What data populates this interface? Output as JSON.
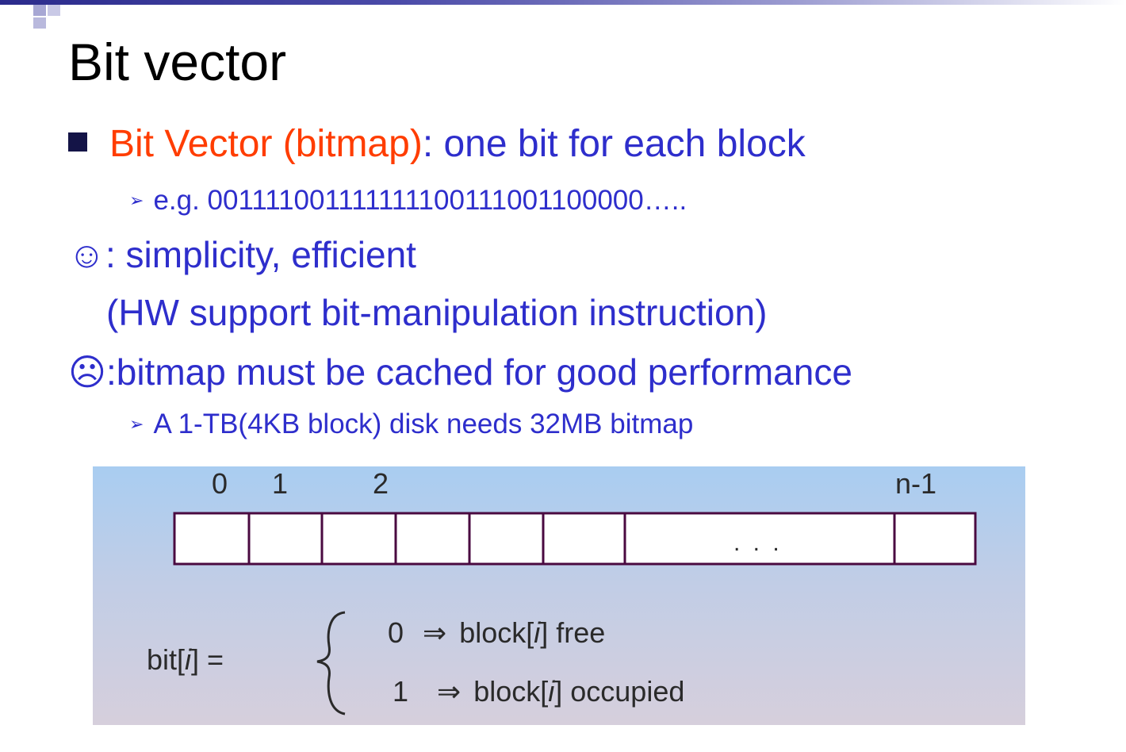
{
  "slide": {
    "title": "Bit vector",
    "bullet1": {
      "red_part": "Bit Vector (bitmap)",
      "rest": ": one bit for each block"
    },
    "sub1": "e.g. 001111001111111100111001100000…..",
    "pro_icon": "☺",
    "pro": ": simplicity, efficient",
    "pro_detail": "(HW support bit-manipulation instruction)",
    "con_icon": "☹",
    "con": ":bitmap must be cached for good performance",
    "sub2": "A 1-TB(4KB block) disk needs 32MB bitmap",
    "sub_marker": "➢"
  },
  "figure": {
    "indices": {
      "i0": "0",
      "i1": "1",
      "i2": "2",
      "last": "n-1"
    },
    "ellipsis": ". . .",
    "lhs": "bit[",
    "var": "i",
    "rhs_close": "] =",
    "case0": {
      "val": "0",
      "arrow": "⇒",
      "text_a": "block[",
      "var": "i",
      "text_b": "] free"
    },
    "case1": {
      "val": "1",
      "arrow": "⇒",
      "text_a": "block[",
      "var": "i",
      "text_b": "] occupied"
    }
  },
  "colors": {
    "title": "#000000",
    "body": "#2e2ecc",
    "highlight": "#ff3d00"
  },
  "icons": [
    "square-bullet-icon",
    "arrowhead-bullet-icon",
    "smiley-icon",
    "frowny-icon"
  ]
}
